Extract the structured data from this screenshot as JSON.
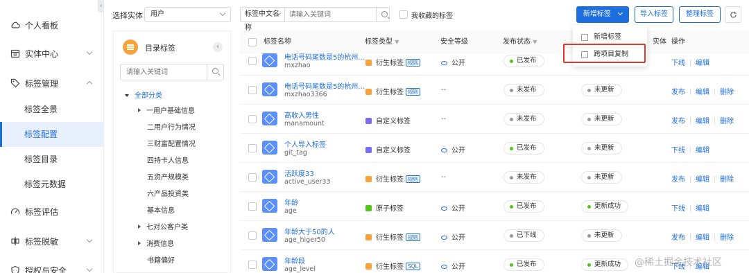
{
  "sidebar": {
    "items": [
      {
        "label": "个人看板",
        "icon": "cloud-icon"
      },
      {
        "label": "实体中心",
        "icon": "calendar-icon"
      },
      {
        "label": "标签管理",
        "icon": "tag-icon"
      },
      {
        "label": "标签评估",
        "icon": "gauge-icon"
      },
      {
        "label": "标签脱敏",
        "icon": "desensitize-icon"
      },
      {
        "label": "授权与安全",
        "icon": "shield-icon"
      }
    ],
    "sub_items": [
      "标签全景",
      "标签配置",
      "标签目录",
      "标签元数据"
    ],
    "active": "标签配置"
  },
  "toolbar": {
    "entity_label": "选择实体",
    "entity_value": "用户",
    "search_field": "标签中文名称",
    "search_placeholder": "请输入关键词",
    "favorite_label": "我收藏的标签",
    "add_label": "新增标签",
    "import_label": "导入标签",
    "organize_label": "整理标签"
  },
  "dropdown": {
    "items": [
      "新增标签",
      "跨项目复制"
    ]
  },
  "tree": {
    "title": "目录标签",
    "search_placeholder": "请输入关键词",
    "root": "全部分类",
    "nodes": [
      {
        "label": "一用户基础信息",
        "expand": true
      },
      {
        "label": "二用户行为情况",
        "expand": false
      },
      {
        "label": "三财富配置情况",
        "expand": false
      },
      {
        "label": "四持卡人信息",
        "expand": false
      },
      {
        "label": "五资产规模类",
        "expand": false
      },
      {
        "label": "六产品投资类",
        "expand": false
      },
      {
        "label": "基本信息",
        "expand": false
      },
      {
        "label": "七对公客户类",
        "expand": true
      },
      {
        "label": "消费信息",
        "expand": true
      },
      {
        "label": "书籍偏好",
        "expand": false
      }
    ]
  },
  "table": {
    "headers": [
      "标签名称",
      "标签类型",
      "安全等级",
      "发布状态",
      "实体",
      "操作"
    ],
    "rows": [
      {
        "name": "电话号码尾数是5的杭州...",
        "code": "mxzhao",
        "type": "衍生标签",
        "badge": "规则",
        "type_color": "#f7a23b",
        "security": "公开",
        "status": "已发布",
        "status_color": "#52c41a",
        "update": "",
        "update_color": "",
        "ops": [
          "下线",
          "编辑"
        ]
      },
      {
        "name": "电话号码尾数是5的杭州...",
        "code": "mxzhao3366",
        "type": "衍生标签",
        "badge": "规则",
        "type_color": "#f7a23b",
        "security": "--",
        "status": "未发布",
        "status_color": "#999999",
        "update": "未更新",
        "update_color": "#999999",
        "ops": [
          "发布",
          "编辑",
          "删除"
        ]
      },
      {
        "name": "高收入男性",
        "code": "manamount",
        "type": "自定义标签",
        "badge": "",
        "type_color": "#7b6cf6",
        "security": "--",
        "status": "未发布",
        "status_color": "#999999",
        "update": "未更新",
        "update_color": "#999999",
        "ops": [
          "发布",
          "编辑",
          "删除"
        ]
      },
      {
        "name": "个人导入标签",
        "code": "git_tag",
        "type": "自定义标签",
        "badge": "",
        "type_color": "#7b6cf6",
        "security": "公开",
        "status": "已发布",
        "status_color": "#52c41a",
        "update": "未更新",
        "update_color": "#999999",
        "ops": [
          "下线",
          "编辑"
        ]
      },
      {
        "name": "活跃度33",
        "code": "active_user33",
        "type": "衍生标签",
        "badge": "规则",
        "type_color": "#f7a23b",
        "security": "--",
        "status": "未发布",
        "status_color": "#999999",
        "update": "未更新",
        "update_color": "#999999",
        "ops": [
          "发布",
          "编辑",
          "删除"
        ]
      },
      {
        "name": "年龄",
        "code": "age",
        "type": "原子标签",
        "badge": "",
        "type_color": "#52c41a",
        "security": "公开",
        "status": "已发布",
        "status_color": "#52c41a",
        "update": "更新成功",
        "update_color": "#52c41a",
        "ops": [
          "下线",
          "编辑"
        ]
      },
      {
        "name": "年龄大于50的人",
        "code": "age_higer50",
        "type": "衍生标签",
        "badge": "规则",
        "type_color": "#f7a23b",
        "security": "公开",
        "status": "已下线",
        "status_color": "#999999",
        "update": "未更新",
        "update_color": "#999999",
        "ops": [
          "发布",
          "编辑",
          "删除"
        ]
      },
      {
        "name": "年龄段",
        "code": "age_level",
        "type": "衍生标签",
        "badge": "SQL",
        "type_color": "#f7a23b",
        "security": "公开",
        "status": "已发布",
        "status_color": "#52c41a",
        "update": "更新成功",
        "update_color": "#52c41a",
        "ops": [
          "下线",
          "编辑"
        ]
      }
    ]
  },
  "watermark": "@稀土掘金技术社区"
}
